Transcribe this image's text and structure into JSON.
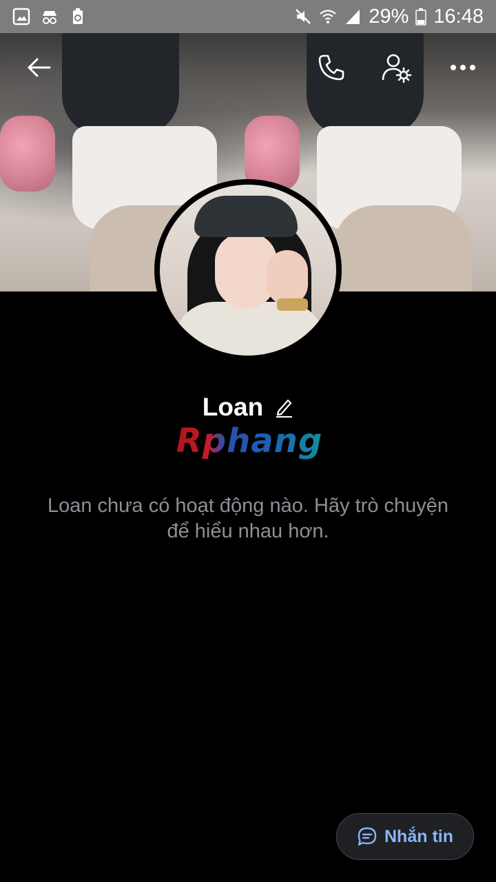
{
  "status_bar": {
    "battery_percent": "29%",
    "time": "16:48",
    "left_icons": [
      "image-icon",
      "incognito-icon",
      "recycle-icon"
    ],
    "right_icons": [
      "mute-icon",
      "wifi-icon",
      "signal-icon",
      "battery-icon"
    ]
  },
  "header": {
    "icons": [
      "back-arrow-icon",
      "phone-icon",
      "user-settings-icon",
      "more-icon"
    ]
  },
  "profile": {
    "name": "Loan",
    "watermark": "Rphang",
    "empty_message": "Loan chưa có hoạt động nào. Hãy trò chuyện để hiểu nhau hơn."
  },
  "actions": {
    "message_label": "Nhắn tin"
  },
  "colors": {
    "status_bar": "#7d7d7d",
    "background": "#000000",
    "accent": "#8ab4f8",
    "muted_text": "#8c9096"
  }
}
